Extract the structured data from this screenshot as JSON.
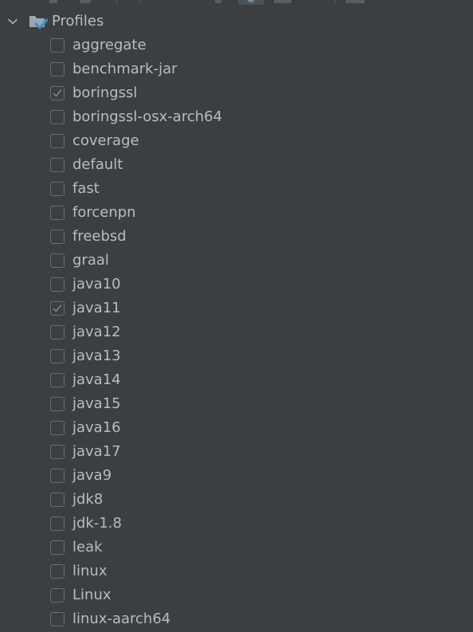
{
  "header": {
    "label": "Profiles",
    "expanded": true,
    "toggle_icon": "chevron-down-icon",
    "icon": "profiles-folder-check-icon"
  },
  "profiles": [
    {
      "label": "aggregate",
      "checked": false
    },
    {
      "label": "benchmark-jar",
      "checked": false
    },
    {
      "label": "boringssl",
      "checked": true
    },
    {
      "label": "boringssl-osx-arch64",
      "checked": false
    },
    {
      "label": "coverage",
      "checked": false
    },
    {
      "label": "default",
      "checked": false
    },
    {
      "label": "fast",
      "checked": false
    },
    {
      "label": "forcenpn",
      "checked": false
    },
    {
      "label": "freebsd",
      "checked": false
    },
    {
      "label": "graal",
      "checked": false
    },
    {
      "label": "java10",
      "checked": false
    },
    {
      "label": "java11",
      "checked": true
    },
    {
      "label": "java12",
      "checked": false
    },
    {
      "label": "java13",
      "checked": false
    },
    {
      "label": "java14",
      "checked": false
    },
    {
      "label": "java15",
      "checked": false
    },
    {
      "label": "java16",
      "checked": false
    },
    {
      "label": "java17",
      "checked": false
    },
    {
      "label": "java9",
      "checked": false
    },
    {
      "label": "jdk8",
      "checked": false
    },
    {
      "label": "jdk-1.8",
      "checked": false
    },
    {
      "label": "leak",
      "checked": false
    },
    {
      "label": "linux",
      "checked": false
    },
    {
      "label": "Linux",
      "checked": false
    },
    {
      "label": "linux-aarch64",
      "checked": false
    }
  ],
  "colors": {
    "background": "#3c3f41",
    "text": "#bbbbbb",
    "checkbox_border": "#6b6e70",
    "checkmark": "#8c8c8c",
    "folder_icon": "#9aa7b0",
    "folder_check": "#3592c4"
  }
}
